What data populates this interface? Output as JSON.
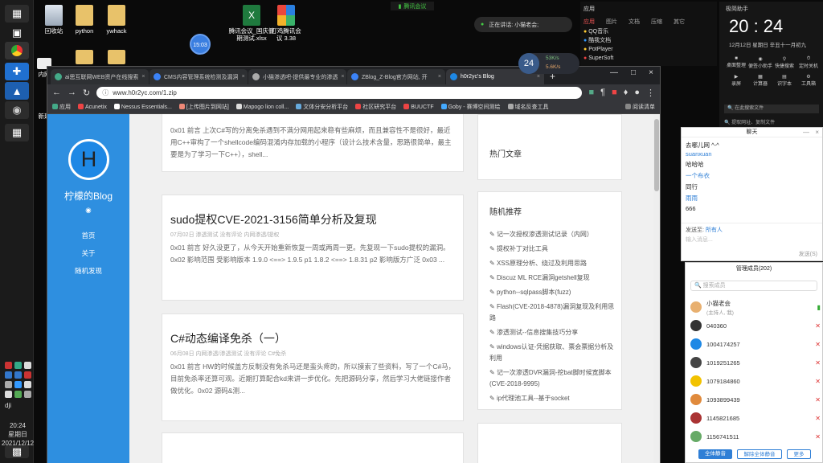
{
  "desktop": {
    "icons": [
      {
        "label": "回收站"
      },
      {
        "label": "python"
      },
      {
        "label": "ywhack"
      },
      {
        "label": "内网"
      },
      {
        "label": "新建"
      },
      {
        "label": "腾讯会议_国庆假期测试.xlsx"
      },
      {
        "label": "打鸡腾讯会议 3.38"
      }
    ]
  },
  "share_bar": {
    "text": "腾讯会议"
  },
  "sharing_pill": {
    "text": "正在讲话: 小猫老会;"
  },
  "blue_circle": {
    "text": "15:03"
  },
  "speed_badge": {
    "value": "24",
    "up": "53K/s",
    "down": "5.6K/s"
  },
  "left_clock": {
    "time": "20:24",
    "weekday": "星期日",
    "date": "2021/12/12"
  },
  "browser": {
    "tabs": [
      {
        "label": "ai思互联网WEB资产在线搜索",
        "color": "#4a8"
      },
      {
        "label": "CMS内容管理系统检测及漏洞",
        "color": "#3b82f6"
      },
      {
        "label": "小猫渗透吧-提供最专业的渗透",
        "color": "#aaa"
      },
      {
        "label": "ZBlog_Z-Blog官方网站, 开",
        "color": "#3b82f6"
      },
      {
        "label": "h0r2yc's Blog",
        "color": "#1e88e5",
        "active": true
      }
    ],
    "url": "www.h0r2yc.com/1.zip",
    "bookmarks": [
      "应用",
      "Acunetix",
      "Nessus Essentials...",
      "[上传图片到网站]",
      "Mapogo lion coll...",
      "文体分安分析平台",
      "社区研究平台",
      "BUUCTF",
      "Goby - 赛博空间测绘",
      "域名反查工具",
      "阅读清单"
    ]
  },
  "blog": {
    "avatar_letter": "H",
    "site_name": "柠檬的Blog",
    "rss": "☰",
    "nav": [
      "首页",
      "关于",
      "随机发现"
    ],
    "posts": [
      {
        "title": "",
        "meta": "",
        "excerpt": "0x01 前言 上次C#写的分离免杀遇到不满分网用起来稳有些麻烦，而且兼容性不是很好，最近用C++审构了一个shellcode编码混淆内存加载的小程序（设计么技术含量，思路很简单，最主要是为了学习一下C++），shell..."
      },
      {
        "title": "sudo提权CVE-2021-3156简单分析及复现",
        "meta": "07月02日  渗透测试  没有评论  内网渗透/提权",
        "excerpt": "0x01 前言 好久没更了，从今天开始重新恢复一周或两周一更。先复现一下sudo提权的漏洞。0x02 影响范围 受影响版本 1.9.0 <==> 1.9.5 p1 1.8.2 <==> 1.8.31 p2 影响版方广泛 0x03 ..."
      },
      {
        "title": "C#动态编译免杀（一）",
        "meta": "06月08日  内网渗透/渗透测试  没有评论  C#免杀",
        "excerpt": "0x01 前言 HW的时候盖方反制没有免杀马还是蛮头疼的，所以摸索了些资料，写了一个C#马，目前免杀率还算可观。近期打算配合kd来讲一步优化。先把源码分享，然后学习大佬链接作者做优化。0x02 源码&测..."
      }
    ],
    "widgets": {
      "hot_title": "热门文章",
      "random_title": "随机推荐",
      "random_items": [
        "记一次授权渗透测试记录（内网）",
        "提权补丁对比工具",
        "XSS原理分析、绕过及利用思路",
        "Discuz ML RCE漏洞getshell复现",
        "python--sqlpass脚本(fuzz)",
        "Flash(CVE-2018-4878)漏洞复现及利用思路",
        "渗透测试--信息搜集技巧分享",
        "windows认证-凭据获取、票会票据分析及利用",
        "记一次渗透DVR漏洞-挖bat脚时候宽脚本(CVE-2018-9995)",
        "ip代理池工具--基于socket"
      ]
    }
  },
  "file_list": {
    "header": "应用",
    "cols": [
      "应用",
      "图片",
      "文档",
      "压缩",
      "其它"
    ],
    "items": [
      "QQ音乐",
      "酷我文档",
      "PotPlayer",
      "SuperSoft"
    ]
  },
  "clock_panel": {
    "title": "极简助手",
    "time": "20 : 24",
    "date": "12月12日  星期日  辛丑十一月初九",
    "tools": [
      "桌面整理",
      "便签小助手",
      "快捷搜索",
      "定时关机",
      "录屏",
      "计算器",
      "识字本",
      "工具箱"
    ],
    "search_label": "在此搜索文件",
    "recent_label": "提取网址、复制文件"
  },
  "chat": {
    "title": "聊天",
    "messages": [
      {
        "text": "去哪儿网 ^-^",
        "color": "#333"
      },
      {
        "text": "suanxuan",
        "color": "#2f7fd6"
      },
      {
        "text": "哈哈哈",
        "color": "#333"
      },
      {
        "text": "一个布衣",
        "color": "#2f7fd6"
      },
      {
        "text": "同行",
        "color": "#333"
      },
      {
        "text": "雨雨",
        "color": "#2f7fd6"
      },
      {
        "text": "666",
        "color": "#333"
      }
    ],
    "send_to_label": "发送至:",
    "send_to_value": "所有人",
    "input_placeholder": "输入消息...",
    "send_btn": "发送(S)"
  },
  "members": {
    "title": "管理成员(202)",
    "search_placeholder": "搜索成员",
    "list": [
      {
        "name": "小猫老会",
        "sub": "(主持人, 我)",
        "color": "#e8b070"
      },
      {
        "name": "040360",
        "color": "#333"
      },
      {
        "name": "1004174257",
        "color": "#1e88e5"
      },
      {
        "name": "1019251265",
        "color": "#444"
      },
      {
        "name": "1079184860",
        "color": "#f2c200"
      },
      {
        "name": "1093899439",
        "color": "#e08a3c"
      },
      {
        "name": "1145821685",
        "color": "#a33"
      },
      {
        "name": "1156741511",
        "color": "#6a6"
      }
    ],
    "buttons": [
      "全体静音",
      "解除全体静音",
      "更多"
    ]
  }
}
